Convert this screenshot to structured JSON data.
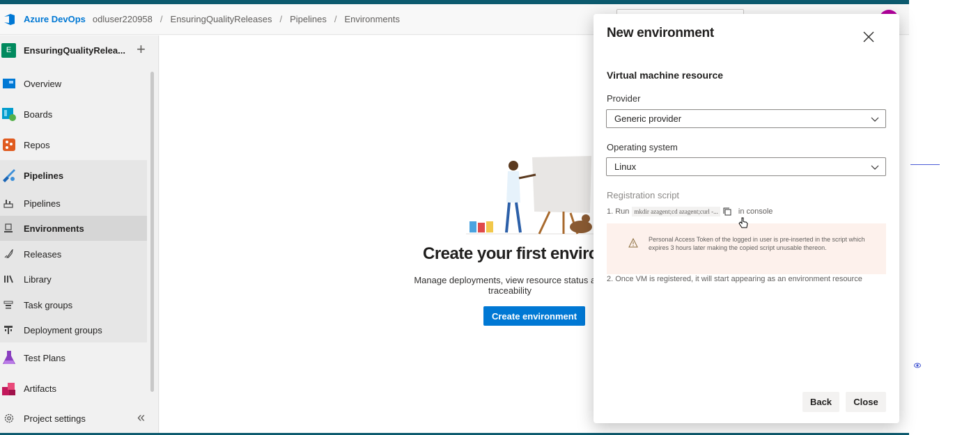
{
  "header": {
    "brand": "Azure DevOps",
    "org": "odluser220958",
    "breadcrumbs": [
      "EnsuringQualityReleases",
      "Pipelines",
      "Environments"
    ],
    "separator": "/"
  },
  "sidebar": {
    "project_initial": "E",
    "project_name": "EnsuringQualityRelea...",
    "add_symbol": "+",
    "items": [
      {
        "label": "Overview",
        "icon": "overview-icon"
      },
      {
        "label": "Boards",
        "icon": "boards-icon"
      },
      {
        "label": "Repos",
        "icon": "repos-icon"
      },
      {
        "label": "Pipelines",
        "icon": "pipelines-icon"
      },
      {
        "label": "Pipelines",
        "icon": "pipelines-sub-icon"
      },
      {
        "label": "Environments",
        "icon": "environments-icon"
      },
      {
        "label": "Releases",
        "icon": "releases-icon"
      },
      {
        "label": "Library",
        "icon": "library-icon"
      },
      {
        "label": "Task groups",
        "icon": "task-groups-icon"
      },
      {
        "label": "Deployment groups",
        "icon": "deployment-groups-icon"
      },
      {
        "label": "Test Plans",
        "icon": "test-plans-icon"
      },
      {
        "label": "Artifacts",
        "icon": "artifacts-icon"
      }
    ],
    "settings_label": "Project settings",
    "collapse_symbol": "«"
  },
  "main": {
    "empty_title": "Create your first enviro",
    "empty_desc": "Manage deployments, view resource status and traceability",
    "cta_label": "Create environment"
  },
  "dialog": {
    "title": "New environment",
    "section": "Virtual machine resource",
    "provider_label": "Provider",
    "provider_value": "Generic provider",
    "os_label": "Operating system",
    "os_value": "Linux",
    "registration_label": "Registration script",
    "step1_prefix": "1. Run",
    "step1_code": "mkdir azagent;cd azagent;curl -...",
    "step1_suffix": "in console",
    "warning": "Personal Access Token of the logged in user is pre-inserted in the script which expires 3 hours later making the copied script unusable thereon.",
    "step2": "2. Once VM is registered, it will start appearing as an environment resource",
    "back_label": "Back",
    "close_label": "Close"
  },
  "colors": {
    "accent": "#0078d4",
    "topbar": "#0c5a6e",
    "project_badge": "#008a5e",
    "warning_bg": "#fdf1ec",
    "avatar": "#b4009e"
  }
}
